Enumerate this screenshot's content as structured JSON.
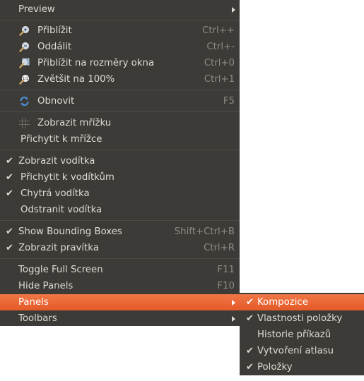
{
  "menu": {
    "preview": "Preview",
    "zoom_in": "Přiblížit",
    "zoom_in_accel": "Ctrl++",
    "zoom_out": "Oddálit",
    "zoom_out_accel": "Ctrl+-",
    "zoom_fit": "Přiblížit na rozměry okna",
    "zoom_fit_accel": "Ctrl+0",
    "zoom_100": "Zvětšit na 100%",
    "zoom_100_accel": "Ctrl+1",
    "refresh": "Obnovit",
    "refresh_accel": "F5",
    "show_grid": "Zobrazit mřížku",
    "snap_grid": "Přichytit k mřížce",
    "show_guides": "Zobrazit vodítka",
    "snap_guides": "Přichytit k vodítkům",
    "smart_guides": "Chytrá vodítka",
    "remove_guides": "Odstranit vodítka",
    "bounding_boxes": "Show Bounding Boxes",
    "bounding_boxes_accel": "Shift+Ctrl+B",
    "show_rulers": "Zobrazit pravítka",
    "show_rulers_accel": "Ctrl+R",
    "full_screen": "Toggle Full Screen",
    "full_screen_accel": "F11",
    "hide_panels": "Hide Panels",
    "hide_panels_accel": "F10",
    "panels": "Panels",
    "toolbars": "Toolbars"
  },
  "submenu": {
    "items": [
      "Kompozice",
      "Vlastnosti položky",
      "Historie příkazů",
      "Vytvoření atlasu",
      "Položky"
    ]
  },
  "colors": {
    "menu_bg": "#3c3b37",
    "highlight": "#e95420",
    "text": "#dfdbd2"
  },
  "icons": [
    "zoom-in-icon",
    "zoom-out-icon",
    "zoom-fit-icon",
    "zoom-actual-icon",
    "refresh-icon",
    "grid-icon",
    "check-icon",
    "submenu-arrow-icon"
  ]
}
